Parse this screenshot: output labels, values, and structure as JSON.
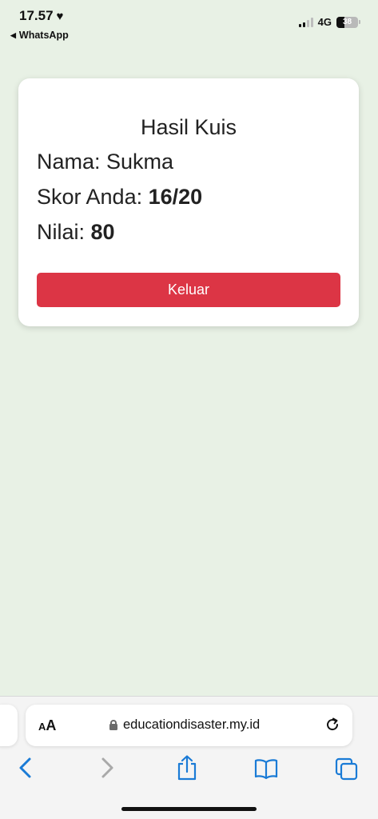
{
  "status_bar": {
    "time": "17.57",
    "back_app": "WhatsApp",
    "network": "4G",
    "battery": "38"
  },
  "quiz_result": {
    "title": "Hasil Kuis",
    "name_label": "Nama: ",
    "name_value": "Sukma",
    "score_label": "Skor Anda: ",
    "score_value": "16/20",
    "grade_label": "Nilai: ",
    "grade_value": "80",
    "exit_button": "Keluar"
  },
  "browser": {
    "aa_large": "A",
    "aa_small": "A",
    "url": "educationdisaster.my.id"
  },
  "colors": {
    "page_background": "#e8f1e5",
    "exit_button": "#dc3545",
    "toolbar_icon": "#1a7bd6"
  },
  "icons": [
    "heart-icon",
    "back-triangle-icon",
    "signal-icon",
    "battery-icon",
    "lock-icon",
    "reload-icon",
    "back-icon",
    "forward-icon",
    "share-icon",
    "bookmarks-icon",
    "tabs-icon"
  ]
}
